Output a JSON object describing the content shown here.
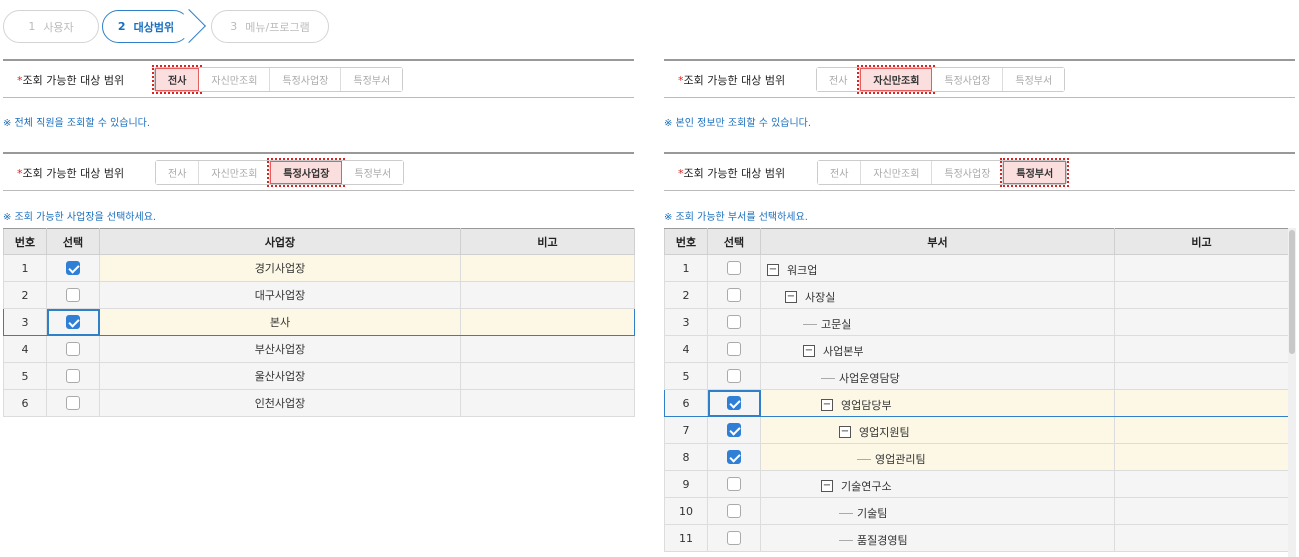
{
  "stepper": {
    "steps": [
      {
        "num": "1",
        "label": "사용자"
      },
      {
        "num": "2",
        "label": "대상범위"
      },
      {
        "num": "3",
        "label": "메뉴/프로그램"
      }
    ]
  },
  "scope_label": "조회 가능한 대상 범위",
  "required_mark": "*",
  "segments": [
    "전사",
    "자신만조회",
    "특정사업장",
    "특정부서"
  ],
  "panels": {
    "p1": {
      "selected": "전사",
      "note": "※ 전체 직원을 조회할 수 있습니다."
    },
    "p2": {
      "selected": "자신만조회",
      "note": "※ 본인 정보만 조회할 수 있습니다."
    },
    "p3": {
      "selected": "특정사업장",
      "note": "※ 조회 가능한 사업장을 선택하세요."
    },
    "p4": {
      "selected": "특정부서",
      "note": "※ 조회 가능한 부서를 선택하세요."
    }
  },
  "site_table": {
    "headers": [
      "번호",
      "선택",
      "사업장",
      "비고"
    ],
    "rows": [
      {
        "no": "1",
        "checked": true,
        "name": "경기사업장",
        "note": ""
      },
      {
        "no": "2",
        "checked": false,
        "name": "대구사업장",
        "note": ""
      },
      {
        "no": "3",
        "checked": true,
        "name": "본사",
        "note": ""
      },
      {
        "no": "4",
        "checked": false,
        "name": "부산사업장",
        "note": ""
      },
      {
        "no": "5",
        "checked": false,
        "name": "울산사업장",
        "note": ""
      },
      {
        "no": "6",
        "checked": false,
        "name": "인천사업장",
        "note": ""
      }
    ]
  },
  "dept_table": {
    "headers": [
      "번호",
      "선택",
      "부서",
      "비고"
    ],
    "rows": [
      {
        "no": "1",
        "checked": false,
        "name": "워크업",
        "depth": 0,
        "expandable": true
      },
      {
        "no": "2",
        "checked": false,
        "name": "사장실",
        "depth": 1,
        "expandable": true
      },
      {
        "no": "3",
        "checked": false,
        "name": "고문실",
        "depth": 2,
        "expandable": false
      },
      {
        "no": "4",
        "checked": false,
        "name": "사업본부",
        "depth": 2,
        "expandable": true
      },
      {
        "no": "5",
        "checked": false,
        "name": "사업운영담당",
        "depth": 3,
        "expandable": false
      },
      {
        "no": "6",
        "checked": true,
        "name": "영업담당부",
        "depth": 3,
        "expandable": true
      },
      {
        "no": "7",
        "checked": true,
        "name": "영업지원팀",
        "depth": 4,
        "expandable": true
      },
      {
        "no": "8",
        "checked": true,
        "name": "영업관리팀",
        "depth": 5,
        "expandable": false
      },
      {
        "no": "9",
        "checked": false,
        "name": "기술연구소",
        "depth": 3,
        "expandable": true
      },
      {
        "no": "10",
        "checked": false,
        "name": "기술팀",
        "depth": 4,
        "expandable": false
      },
      {
        "no": "11",
        "checked": false,
        "name": "품질경영팀",
        "depth": 4,
        "expandable": false
      }
    ]
  }
}
